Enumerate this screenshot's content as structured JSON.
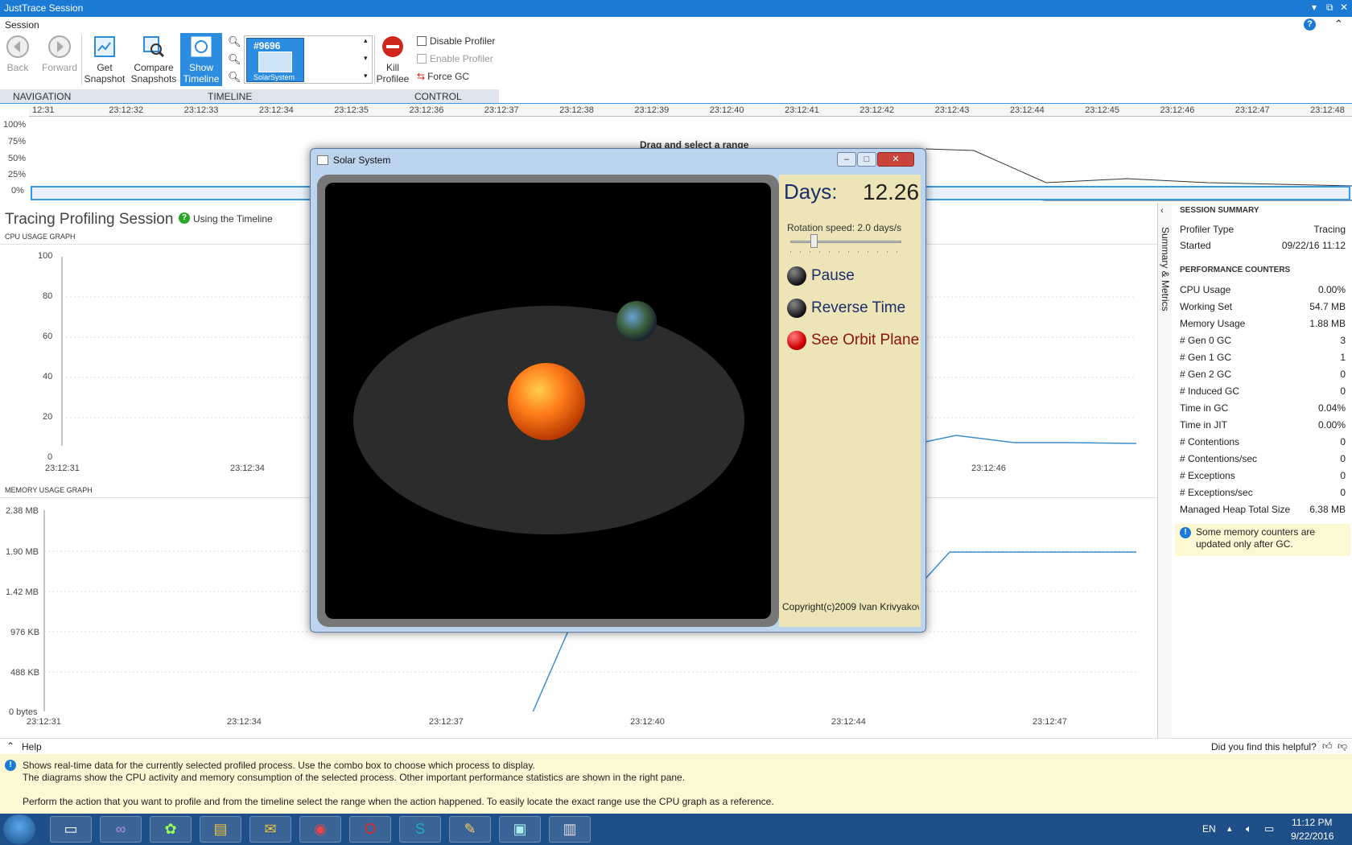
{
  "app": {
    "title": "JustTrace Session",
    "menu": "Session"
  },
  "ribbon": {
    "back": "Back",
    "forward": "Forward",
    "get_snapshot_1": "Get",
    "get_snapshot_2": "Snapshot",
    "compare_1": "Compare",
    "compare_2": "Snapshots",
    "show_timeline_1": "Show",
    "show_timeline_2": "Timeline",
    "process_id": "#9696",
    "process_name": "SolarSystem",
    "kill_1": "Kill",
    "kill_2": "Profilee",
    "disable_profiler": "Disable Profiler",
    "enable_profiler": "Enable Profiler",
    "force_gc": "Force GC",
    "groups": [
      "NAVIGATION",
      "TIMELINE",
      "CONTROL"
    ]
  },
  "timeline": {
    "ticks": [
      "12:31",
      "23:12:32",
      "23:12:33",
      "23:12:34",
      "23:12:35",
      "23:12:36",
      "23:12:37",
      "23:12:38",
      "23:12:39",
      "23:12:40",
      "23:12:41",
      "23:12:42",
      "23:12:43",
      "23:12:44",
      "23:12:45",
      "23:12:46",
      "23:12:47",
      "23:12:48"
    ],
    "ylabels": [
      "100%",
      "75%",
      "50%",
      "25%",
      "0%"
    ],
    "hint": "Drag and select a range"
  },
  "session": {
    "title": "Tracing Profiling Session",
    "help_link": "Using the Timeline",
    "cpu_graph_label": "CPU USAGE GRAPH",
    "memory_graph_label": "MEMORY USAGE GRAPH",
    "cpu_y": [
      "100",
      "80",
      "60",
      "40",
      "20",
      "0"
    ],
    "cpu_x": [
      "23:12:31",
      "23:12:34",
      "23:12:46"
    ],
    "mem_y": [
      "2.38 MB",
      "1.90 MB",
      "1.42 MB",
      "976 KB",
      "488 KB",
      "0 bytes"
    ],
    "mem_x": [
      "23:12:31",
      "23:12:34",
      "23:12:37",
      "23:12:40",
      "23:12:44",
      "23:12:47"
    ]
  },
  "summary": {
    "tab_label": "Summary & Metrics",
    "session_summary": "SESSION SUMMARY",
    "profiler_type_label": "Profiler Type",
    "profiler_type": "Tracing",
    "started_label": "Started",
    "started": "09/22/16  11:12",
    "perf_counters": "PERFORMANCE COUNTERS",
    "counters": [
      {
        "label": "CPU Usage",
        "value": "0.00%"
      },
      {
        "label": "Working Set",
        "value": "54.7 MB"
      },
      {
        "label": "Memory Usage",
        "value": "1.88 MB"
      },
      {
        "label": "# Gen 0 GC",
        "value": "3"
      },
      {
        "label": "# Gen 1 GC",
        "value": "1"
      },
      {
        "label": "# Gen 2 GC",
        "value": "0"
      },
      {
        "label": "# Induced GC",
        "value": "0"
      },
      {
        "label": "Time in GC",
        "value": "0.04%"
      },
      {
        "label": "Time in JIT",
        "value": "0.00%"
      },
      {
        "label": "# Contentions",
        "value": "0"
      },
      {
        "label": "# Contentions/sec",
        "value": "0"
      },
      {
        "label": "# Exceptions",
        "value": "0"
      },
      {
        "label": "# Exceptions/sec",
        "value": "0"
      },
      {
        "label": "Managed Heap Total Size",
        "value": "6.38 MB"
      }
    ],
    "note": "Some memory counters are updated only after GC."
  },
  "help": {
    "title": "Help",
    "feedback": "Did you find this helpful?",
    "line1": "Shows real-time data for the currently selected profiled process. Use the combo box to choose which process to display.",
    "line2": "The diagrams show the CPU activity and memory consumption of the selected process. Other important performance statistics are shown in the right pane.",
    "line3": "Perform the action that you want to profile and from the timeline select the range when the action happened. To easily locate the exact range use the CPU graph as a reference."
  },
  "solar": {
    "window_title": "Solar System",
    "days_label": "Days:",
    "days_value": "12.26",
    "rotation_label": "Rotation speed: 2.0 days/s",
    "rotation_fraction": 0.2,
    "options": [
      {
        "label": "Pause",
        "on": false
      },
      {
        "label": "Reverse Time",
        "on": false
      },
      {
        "label": "See Orbit Plane",
        "on": true
      }
    ],
    "copyright": "Copyright(c)2009 Ivan Krivyakov"
  },
  "taskbar": {
    "lang": "EN",
    "time": "11:12 PM",
    "date": "9/22/2016"
  }
}
